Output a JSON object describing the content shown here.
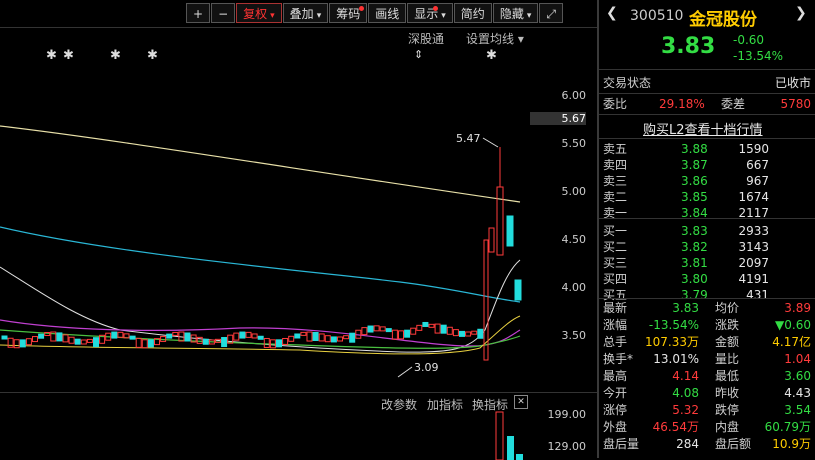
{
  "toolbar": {
    "items": [
      {
        "label": "+"
      },
      {
        "label": "−"
      },
      {
        "label": "复权",
        "caret": "▾"
      },
      {
        "label": "叠加",
        "caret": "▾"
      },
      {
        "label": "筹码"
      },
      {
        "label": "画线"
      },
      {
        "label": "显示",
        "caret": "▾"
      },
      {
        "label": "简约"
      },
      {
        "label": "隐藏",
        "caret": "▾"
      },
      {
        "label": "⤢"
      }
    ]
  },
  "chart_tabs": {
    "shenguotong": "深股通",
    "set_ma": "设置均线 ▾"
  },
  "indicator_tabs": {
    "params": "改参数",
    "add": "加指标",
    "switch": "换指标"
  },
  "price_axis": {
    "ticks": [
      "6.00",
      "5.67",
      "5.50",
      "5.00",
      "4.50",
      "4.00",
      "3.50"
    ],
    "current": "5.67"
  },
  "volume_axis": {
    "ticks": [
      "199.00",
      "129.00"
    ]
  },
  "annotations": {
    "high": "5.47",
    "low": "3.09"
  },
  "stock": {
    "code": "300510",
    "name": "金冠股份",
    "price": "3.83",
    "change": "-0.60",
    "change_pct": "-13.54%"
  },
  "status": {
    "label": "交易状态",
    "value": "已收市"
  },
  "ratio": {
    "label1": "委比",
    "value1": "29.18%",
    "label2": "委差",
    "value2": "5780"
  },
  "l2_link": "购买L2查看十档行情",
  "asks": [
    {
      "label": "卖五",
      "price": "3.88",
      "vol": "1590"
    },
    {
      "label": "卖四",
      "price": "3.87",
      "vol": "667"
    },
    {
      "label": "卖三",
      "price": "3.86",
      "vol": "967"
    },
    {
      "label": "卖二",
      "price": "3.85",
      "vol": "1674"
    },
    {
      "label": "卖一",
      "price": "3.84",
      "vol": "2117"
    }
  ],
  "bids": [
    {
      "label": "买一",
      "price": "3.83",
      "vol": "2933"
    },
    {
      "label": "买二",
      "price": "3.82",
      "vol": "3143"
    },
    {
      "label": "买三",
      "price": "3.81",
      "vol": "2097"
    },
    {
      "label": "买四",
      "price": "3.80",
      "vol": "4191"
    },
    {
      "label": "买五",
      "price": "3.79",
      "vol": "431"
    }
  ],
  "stats": [
    {
      "l1": "最新",
      "v1": "3.83",
      "c1": "green",
      "l2": "均价",
      "v2": "3.89",
      "c2": "red"
    },
    {
      "l1": "涨幅",
      "v1": "-13.54%",
      "c1": "green",
      "l2": "涨跌",
      "v2": "▼0.60",
      "c2": "green"
    },
    {
      "l1": "总手",
      "v1": "107.33万",
      "c1": "yellow",
      "l2": "金额",
      "v2": "4.17亿",
      "c2": "yellow"
    },
    {
      "l1": "换手*",
      "v1": "13.01%",
      "c1": "wht",
      "l2": "量比",
      "v2": "1.04",
      "c2": "red"
    },
    {
      "l1": "最高",
      "v1": "4.14",
      "c1": "red",
      "l2": "最低",
      "v2": "3.60",
      "c2": "green"
    },
    {
      "l1": "今开",
      "v1": "4.08",
      "c1": "green",
      "l2": "昨收",
      "v2": "4.43",
      "c2": "wht"
    },
    {
      "l1": "涨停",
      "v1": "5.32",
      "c1": "red",
      "l2": "跌停",
      "v2": "3.54",
      "c2": "green"
    },
    {
      "l1": "外盘",
      "v1": "46.54万",
      "c1": "red",
      "l2": "内盘",
      "v2": "60.79万",
      "c2": "green"
    },
    {
      "l1": "盘后量",
      "v1": "284",
      "c1": "wht",
      "l2": "盘后额",
      "v2": "10.9万",
      "c2": "yellow"
    }
  ],
  "colors": {
    "up": "#ff3b3b",
    "down": "#22dddd",
    "accent": "#ffcc00"
  }
}
